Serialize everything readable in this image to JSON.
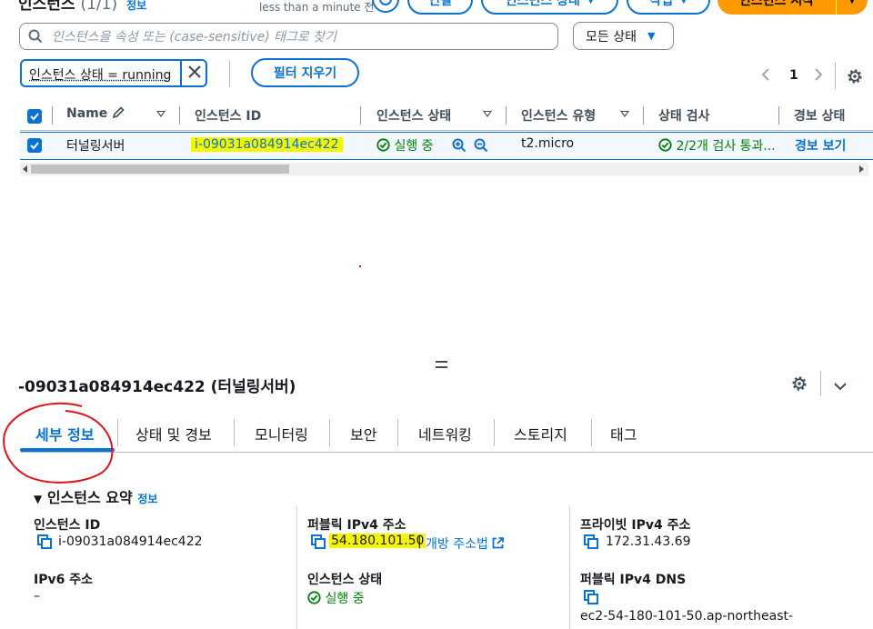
{
  "header": {
    "title": "인스턴스",
    "count": "(1/1)",
    "info_link": "정보",
    "updated": "less than a minute 전",
    "buttons": {
      "connect": "연결",
      "instance_state": "인스턴스 상태",
      "actions": "작업",
      "launch": "인스턴스 시작"
    }
  },
  "search": {
    "placeholder": "인스턴스을 속성 또는 (case-sensitive) 태그로 찾기",
    "state_filter": "모든 상태"
  },
  "filters": {
    "token": "인스턴스 상태 = running",
    "clear_label": "필터 지우기"
  },
  "pagination": {
    "current_page": "1"
  },
  "table": {
    "columns": [
      "Name",
      "인스턴스 ID",
      "인스턴스 상태",
      "인스턴스 유형",
      "상태 검사",
      "경보 상태"
    ],
    "rows": [
      {
        "name": "터널링서버",
        "instance_id": "i-09031a084914ec422",
        "state": "실행 중",
        "type": "t2.micro",
        "status_check": "2/2개 검사 통과...",
        "alarm": "경보 보기"
      }
    ]
  },
  "detail": {
    "title": "-09031a084914ec422 (터널링서버)",
    "tabs": [
      "세부 정보",
      "상태 및 경보",
      "모니터링",
      "보안",
      "네트워킹",
      "스토리지",
      "태그"
    ],
    "active_tab": "세부 정보",
    "summary_title": "인스턴스 요약",
    "summary_info": "정보",
    "fields": {
      "instance_id_label": "인스턴스 ID",
      "instance_id_value": "i-09031a084914ec422",
      "public_ipv4_label": "퍼블릭 IPv4 주소",
      "public_ipv4_value": "54.180.101.50",
      "open_address_link": "개방 주소법",
      "private_ipv4_label": "프라이빗 IPv4 주소",
      "private_ipv4_value": "172.31.43.69",
      "ipv6_label": "IPv6 주소",
      "ipv6_value": "–",
      "instance_state_label": "인스턴스 상태",
      "instance_state_value": "실행 중",
      "public_dns_label": "퍼블릭 IPv4 DNS",
      "public_dns_value": "ec2-54-180-101-50.ap-northeast-"
    }
  },
  "colors": {
    "link": "#0972d3",
    "success": "#037f0c",
    "primary_button": "#ff9900",
    "highlight": "#f6f600",
    "annotation": "#e0131a"
  }
}
